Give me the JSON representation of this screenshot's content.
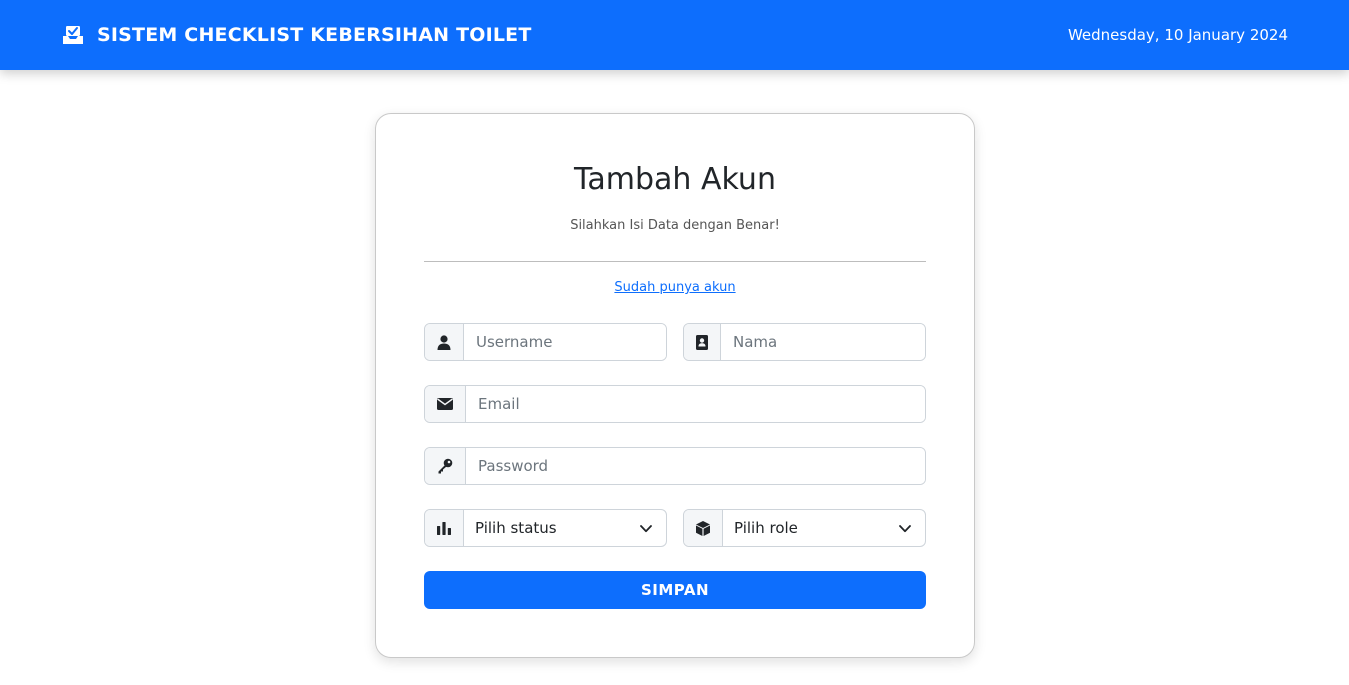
{
  "header": {
    "title": "SISTEM CHECKLIST KEBERSIHAN TOILET",
    "date": "Wednesday, 10 January 2024",
    "brand_icon": "inbox-check-icon"
  },
  "form": {
    "title": "Tambah Akun",
    "subtitle": "Silahkan Isi Data dengan Benar!",
    "login_link": "Sudah punya akun",
    "username": {
      "placeholder": "Username",
      "value": "",
      "icon": "user-icon"
    },
    "nama": {
      "placeholder": "Nama",
      "value": "",
      "icon": "address-book-icon"
    },
    "email": {
      "placeholder": "Email",
      "value": "",
      "icon": "envelope-icon"
    },
    "password": {
      "placeholder": "Password",
      "value": "",
      "icon": "key-icon"
    },
    "status": {
      "selected": "Pilih status",
      "icon": "bar-chart-icon"
    },
    "role": {
      "selected": "Pilih role",
      "icon": "cube-icon"
    },
    "submit_label": "SIMPAN"
  },
  "colors": {
    "primary": "#0d6efd",
    "addon_bg": "#f4f6f8",
    "border": "#ced4da"
  }
}
